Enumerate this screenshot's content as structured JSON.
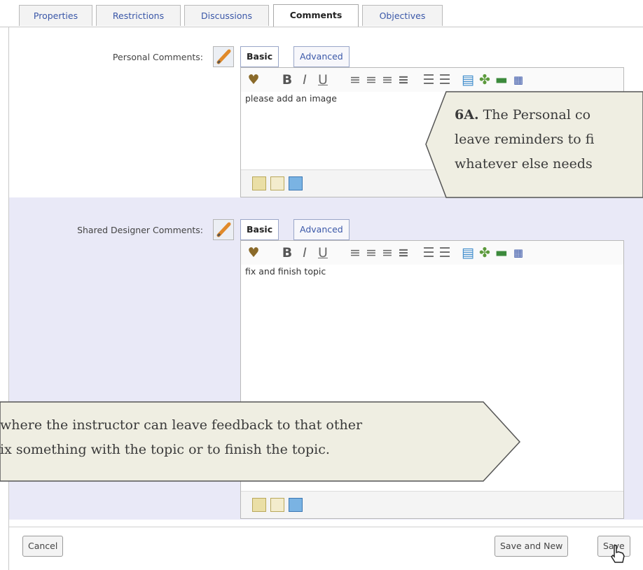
{
  "tabs": [
    "Properties",
    "Restrictions",
    "Discussions",
    "Comments",
    "Objectives"
  ],
  "active_tab": "Comments",
  "personal": {
    "label": "Personal Comments:",
    "mode_tabs": [
      "Basic",
      "Advanced"
    ],
    "content": "please add an image"
  },
  "shared": {
    "label": "Shared Designer Comments:",
    "mode_tabs": [
      "Basic",
      "Advanced"
    ],
    "content": "fix and finish topic"
  },
  "toolbar_icons": [
    "spellcheck-icon",
    "bold-icon",
    "italic-icon",
    "underline-icon",
    "align-left-icon",
    "align-center-icon",
    "align-right-icon",
    "justify-icon",
    "bullet-list-icon",
    "numbered-list-icon",
    "table-icon",
    "link-icon",
    "image-icon",
    "special-icon"
  ],
  "callout_a": {
    "bold": "6A.",
    "line1": " The Personal co",
    "line2": "leave reminders to fi",
    "line3": "whatever else needs"
  },
  "callout_b": {
    "line1": "where the instructor can leave feedback to that other",
    "line2": "ix something with the topic or to finish the topic."
  },
  "buttons": {
    "cancel": "Cancel",
    "save_new": "Save and New",
    "save": "Save"
  },
  "colors": {
    "link": "#3a57a8",
    "shared_bg": "#e9e9f7",
    "callout_fill": "#efeee2"
  }
}
